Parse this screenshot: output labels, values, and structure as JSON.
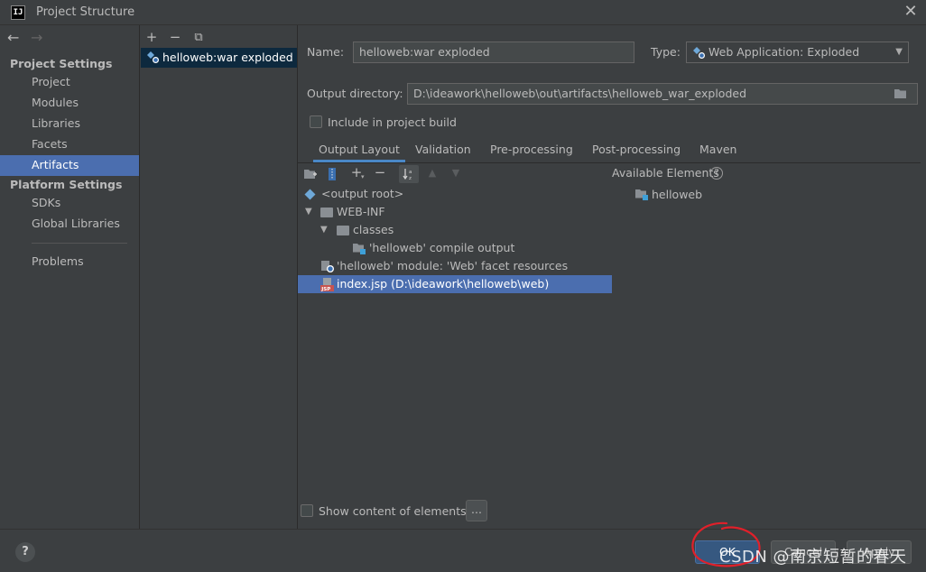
{
  "window": {
    "title": "Project Structure",
    "logo": "IJ"
  },
  "nav": {
    "back": "←",
    "forward": "→",
    "project_settings_heading": "Project Settings",
    "platform_settings_heading": "Platform Settings",
    "items": [
      "Project",
      "Modules",
      "Libraries",
      "Facets",
      "Artifacts",
      "SDKs",
      "Global Libraries",
      "Problems"
    ],
    "selected": "Artifacts"
  },
  "artifacts_toolbar": {
    "add": "+",
    "remove": "−",
    "copy": "⧉"
  },
  "artifacts": [
    "helloweb:war exploded"
  ],
  "form": {
    "name_label": "Name:",
    "name_value": "helloweb:war exploded",
    "type_label": "Type:",
    "type_value": "Web Application: Exploded",
    "output_dir_label": "Output directory:",
    "output_dir_value": "D:\\ideawork\\helloweb\\out\\artifacts\\helloweb_war_exploded",
    "include_build_label": "Include in project build"
  },
  "tabs": [
    "Output Layout",
    "Validation",
    "Pre-processing",
    "Post-processing",
    "Maven"
  ],
  "active_tab": "Output Layout",
  "available_elements_label": "Available Elements",
  "available": [
    "helloweb"
  ],
  "tree": [
    {
      "label": "<output root>",
      "icon": "output-root-icon"
    },
    {
      "label": "WEB-INF",
      "icon": "folder-icon"
    },
    {
      "label": "classes",
      "icon": "folder-icon"
    },
    {
      "label": "'helloweb' compile output",
      "icon": "compile-output-icon"
    },
    {
      "label": "'helloweb' module: 'Web' facet resources",
      "icon": "web-facet-icon"
    },
    {
      "label": "index.jsp (D:\\ideawork\\helloweb\\web)",
      "icon": "jsp-file-icon"
    }
  ],
  "selected_tree_item": "index.jsp (D:\\ideawork\\helloweb\\web)",
  "show_content_label": "Show content of elements",
  "ellipsis": "...",
  "bottom": {
    "help": "?",
    "ok": "OK",
    "cancel": "Cancel",
    "apply": "Apply"
  },
  "watermark": "CSDN @南京短暂的春天",
  "colors": {
    "background": "#3c3f41",
    "selection": "#4b6eaf",
    "accent": "#4a88c7",
    "annotation": "#e0202a"
  }
}
